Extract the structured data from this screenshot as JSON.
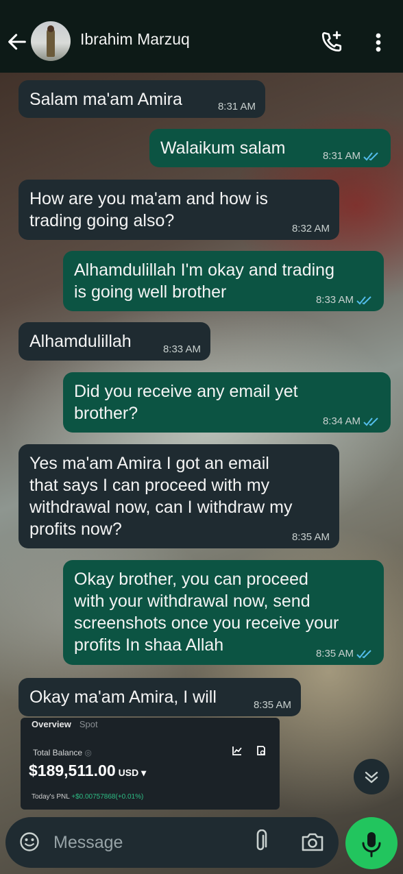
{
  "header": {
    "contact_name": "Ibrahim Marzuq",
    "back_icon": "arrow-left-icon",
    "call_icon": "add-call-icon",
    "menu_icon": "more-vertical-icon"
  },
  "messages": [
    {
      "dir": "in",
      "text": "Salam ma'am Amira",
      "time": "8:31 AM"
    },
    {
      "dir": "out",
      "text": "Walaikum salam",
      "time": "8:31 AM"
    },
    {
      "dir": "in",
      "text": "How are you ma'am and how is\ntrading going also?",
      "time": "8:32 AM"
    },
    {
      "dir": "out",
      "text": "Alhamdulillah I'm okay and trading\nis going well brother",
      "time": "8:33 AM"
    },
    {
      "dir": "in",
      "text": "Alhamdulillah",
      "time": "8:33 AM"
    },
    {
      "dir": "out",
      "text": "Did you receive any email yet\nbrother?",
      "time": "8:34 AM"
    },
    {
      "dir": "in",
      "text": "Yes ma'am Amira I got an email\nthat says I can proceed with my\nwithdrawal now, can I withdraw my\nprofits now?",
      "time": "8:35 AM"
    },
    {
      "dir": "out",
      "text": "Okay brother, you can proceed\nwith your withdrawal now, send\nscreenshots once you receive your\nprofits In shaa Allah",
      "time": "8:35 AM"
    },
    {
      "dir": "in",
      "text": "Okay ma'am Amira, I will",
      "time": "8:35 AM"
    }
  ],
  "attachment": {
    "tab_overview": "Overview",
    "tab_spot": "Spot",
    "total_balance_label": "Total Balance",
    "balance": "$189,511.00",
    "currency": "USD ▾",
    "pnl_label": "Today's PNL",
    "pnl_value": "+$0.00757868(+0.01%)"
  },
  "composer": {
    "placeholder": "Message"
  },
  "colors": {
    "incoming_bubble": "#1f2b31",
    "outgoing_bubble": "#0c5443",
    "read_ticks": "#53bdeb",
    "mic_button": "#22c55e"
  }
}
